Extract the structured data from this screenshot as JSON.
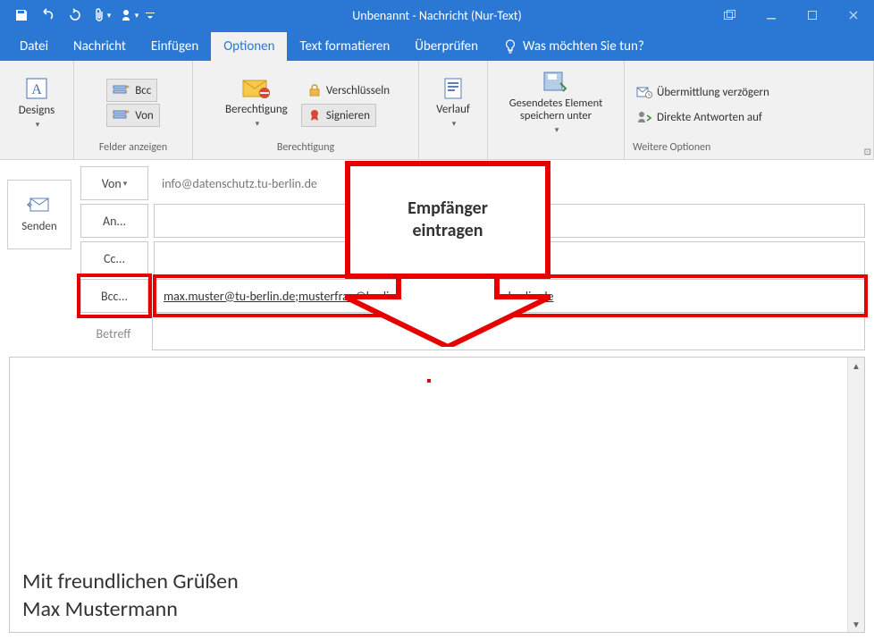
{
  "titlebar": {
    "title": "Unbenannt - Nachricht (Nur-Text)"
  },
  "tabs": {
    "datei": "Datei",
    "nachricht": "Nachricht",
    "einfuegen": "Einfügen",
    "optionen": "Optionen",
    "text_formatieren": "Text formatieren",
    "ueberpruefen": "Überprüfen",
    "tellme": "Was möchten Sie tun?"
  },
  "ribbon": {
    "designs": "Designs",
    "bcc": "Bcc",
    "von_btn": "Von",
    "group_felder": "Felder anzeigen",
    "berechtigung": "Berechtigung",
    "verschluesseln": "Verschlüsseln",
    "signieren": "Signieren",
    "group_berechtigung": "Berechtigung",
    "verlauf": "Verlauf",
    "gesendetes": "Gesendetes Element speichern unter",
    "uebermittlung": "Übermittlung verzögern",
    "direkte": "Direkte Antworten auf",
    "group_weitere": "Weitere Optionen"
  },
  "annotation": {
    "line1": "Empfänger",
    "line2": "eintragen"
  },
  "compose": {
    "senden": "Senden",
    "von": "Von",
    "von_value": "info@datenschutz.tu-berlin.de",
    "an": "An...",
    "cc": "Cc...",
    "bcc": "Bcc...",
    "bcc_value_1": "max.muster@tu-berlin.de",
    "bcc_value_2": "musterfrau@berlin.de",
    "bcc_value_3": "mustermann@hu-berlin.de",
    "betreff": "Betreff"
  },
  "body": {
    "sig1": "Mit freundlichen Grüßen",
    "sig2": "Max Mustermann"
  }
}
